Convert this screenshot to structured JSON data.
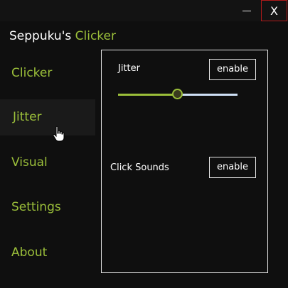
{
  "window": {
    "minimize_symbol": "—",
    "close_label": "X"
  },
  "app_title": {
    "prefix": "Seppuku's",
    "accent": "Clicker"
  },
  "nav": {
    "items": [
      {
        "label": "Clicker"
      },
      {
        "label": "Jitter"
      },
      {
        "label": "Visual"
      },
      {
        "label": "Settings"
      },
      {
        "label": "About"
      }
    ],
    "active": "Jitter"
  },
  "panel": {
    "jitter": {
      "label": "Jitter",
      "button": "enable",
      "slider_fraction": 0.5
    },
    "click_sounds": {
      "label": "Click Sounds",
      "button": "enable"
    }
  },
  "colors": {
    "accent": "#9bbf3a",
    "background": "#0f0f0f",
    "close_border": "#b01a1a",
    "slider_track": "#cfe0f6"
  }
}
